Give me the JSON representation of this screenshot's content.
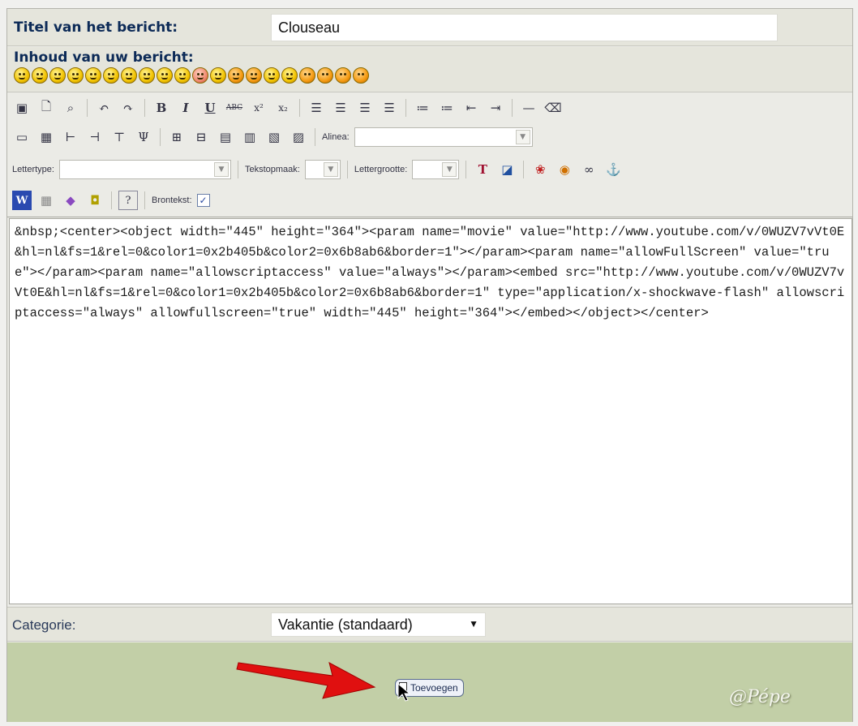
{
  "form": {
    "title_label": "Titel van het bericht:",
    "title_value": "Clouseau",
    "content_label": "Inhoud van uw bericht:",
    "smileys": [
      "smile",
      "grin",
      "sad",
      "surprised",
      "confused",
      "smile",
      "cool",
      "laugh",
      "tongue",
      "big-grin",
      "shocked",
      "cry",
      "evil",
      "twisted",
      "razz",
      "wink",
      "exclaim",
      "question",
      "idea",
      "arrow"
    ]
  },
  "toolbar": {
    "alinea_label": "Alinea:",
    "lettertype_label": "Lettertype:",
    "tekstopmaak_label": "Tekstopmaak:",
    "lettergrootte_label": "Lettergrootte:",
    "brontekst_label": "Brontekst:",
    "brontekst_checked": "✓",
    "bold": "B",
    "italic": "I",
    "underline": "U",
    "strike": "ABC",
    "superscript": "x²",
    "subscript": "x₂"
  },
  "editor": {
    "source": "&nbsp;<center><object width=\"445\" height=\"364\"><param name=\"movie\" value=\"http://www.youtube.com/v/0WUZV7vVt0E&hl=nl&fs=1&rel=0&color1=0x2b405b&color2=0x6b8ab6&border=1\"></param><param name=\"allowFullScreen\" value=\"true\"></param><param name=\"allowscriptaccess\" value=\"always\"></param><embed src=\"http://www.youtube.com/v/0WUZV7vVt0E&hl=nl&fs=1&rel=0&color1=0x2b405b&color2=0x6b8ab6&border=1\" type=\"application/x-shockwave-flash\" allowscriptaccess=\"always\" allowfullscreen=\"true\" width=\"445\" height=\"364\"></embed></object></center>"
  },
  "category": {
    "label": "Categorie:",
    "selected": "Vakantie (standaard)"
  },
  "footer": {
    "add_label": "Toevoegen",
    "watermark": "@Pépe"
  },
  "colors": {
    "label_text": "#0c2a57",
    "footer_bg": "#c2cfa7",
    "arrow": "#e01010"
  }
}
